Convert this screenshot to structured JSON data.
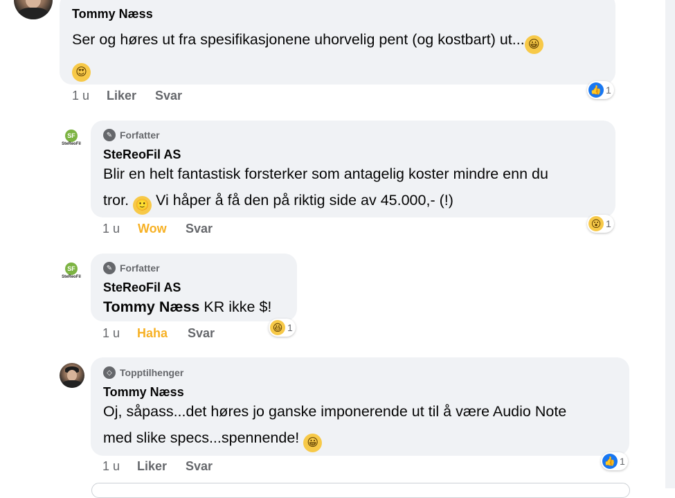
{
  "comments": [
    {
      "author": "Tommy Næss",
      "text_line1": "Ser og høres ut fra spesifikasjonene uhorvelig pent (og kostbart) ut...",
      "emoji1": "😀",
      "emoji2": "😍",
      "time": "1 u",
      "action": "Liker",
      "reply": "Svar",
      "reaction_icon": "like-icon",
      "reaction_count": "1"
    },
    {
      "badge": "Forfatter",
      "author": "SteReoFil AS",
      "text_line1": "Blir en helt fantastisk forsterker som antagelig koster mindre enn du",
      "text_line2a": "tror.",
      "emoji": "🙂",
      "text_line2b": "Vi håper å få den på riktig side av 45.000,- (!)",
      "time": "1 u",
      "action": "Wow",
      "reply": "Svar",
      "reaction_icon": "wow-icon",
      "reaction_count": "1"
    },
    {
      "badge": "Forfatter",
      "author": "SteReoFil AS",
      "mention": "Tommy Næss",
      "text": "KR ikke $!",
      "time": "1 u",
      "action": "Haha",
      "reply": "Svar",
      "reaction_icon": "haha-icon",
      "reaction_count": "1"
    },
    {
      "badge": "Topptilhenger",
      "author": "Tommy Næss",
      "text_line1": "Oj, såpass...det høres jo ganske imponerende ut til å være Audio Note",
      "text_line2": "med slike specs...spennende!",
      "emoji": "😀",
      "time": "1 u",
      "action": "Liker",
      "reply": "Svar",
      "reaction_icon": "like-icon",
      "reaction_count": "1"
    }
  ],
  "logo": {
    "mark": "SF",
    "text": "SteReoFil"
  },
  "colors": {
    "bubble": "#f0f2f5",
    "meta": "#65676b",
    "like_blue": "#1877f2",
    "wow_yellow": "#f7b125"
  }
}
